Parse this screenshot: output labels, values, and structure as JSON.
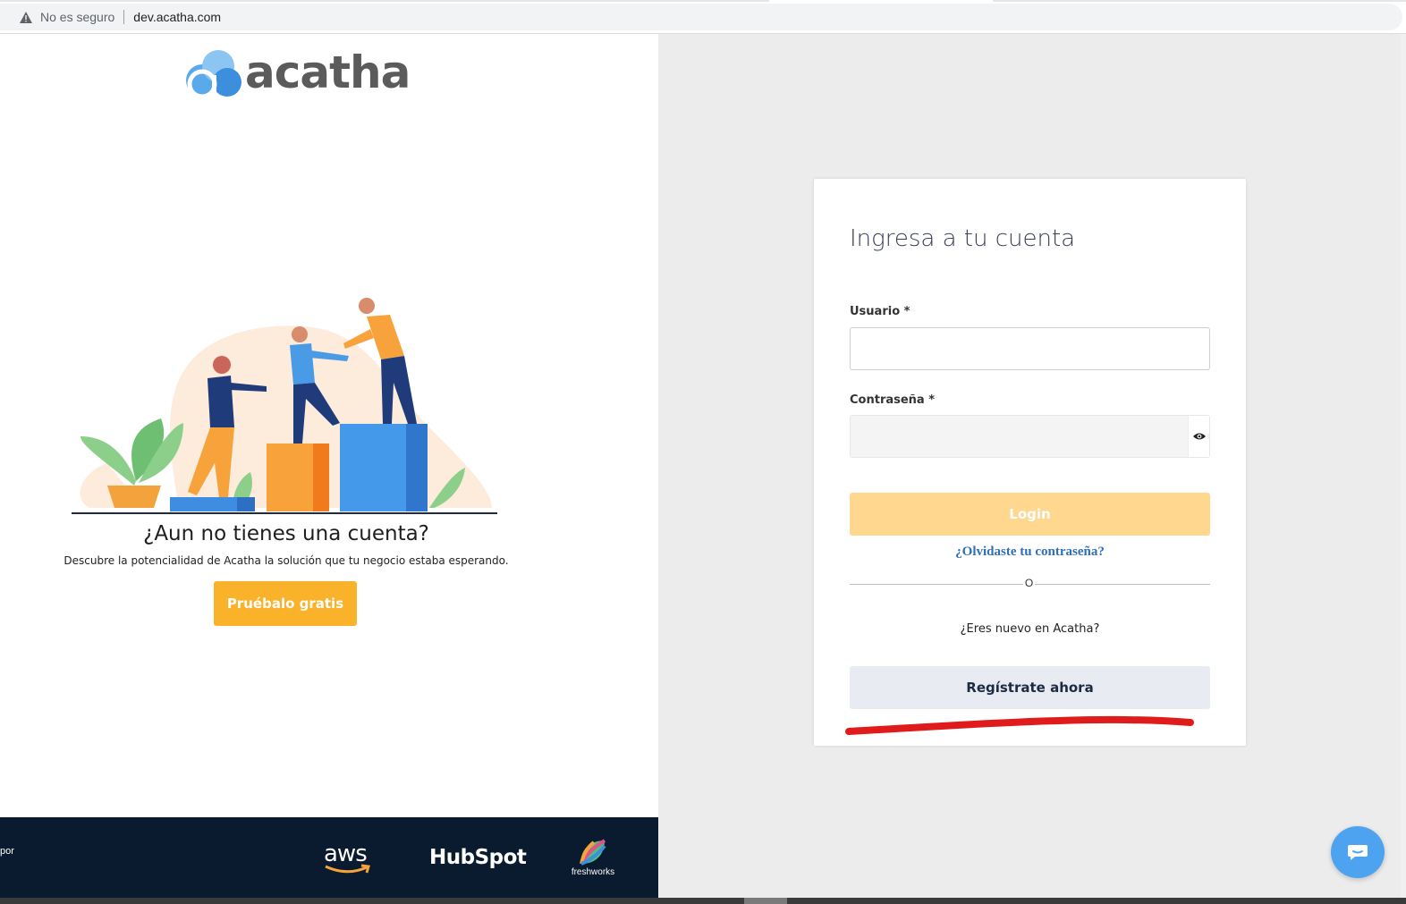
{
  "browser": {
    "security_label": "No es seguro",
    "url": "dev.acatha.com"
  },
  "brand": {
    "logo_text": "acatha",
    "colors": {
      "primary_yellow": "#fbb22b",
      "light_blue": "#4da3f0",
      "dark_navy": "#0b1b2f"
    }
  },
  "promo": {
    "title": "¿Aun no tienes una cuenta?",
    "subtitle": "Descubre la potencialidad de Acatha la solución que tu negocio estaba esperando.",
    "cta_label": "Pruébalo gratis"
  },
  "footer": {
    "partial_text": "por",
    "partners": [
      "aws",
      "HubSpot",
      "freshworks"
    ]
  },
  "login_card": {
    "title": "Ingresa a tu cuenta",
    "username_label": "Usuario *",
    "username_value": "",
    "password_label": "Contraseña *",
    "password_value": "",
    "login_label": "Login",
    "forgot_label": "¿Olvidaste tu contraseña?",
    "or_label": "O",
    "new_user_question": "¿Eres nuevo en Acatha?",
    "register_label": "Regístrate ahora"
  },
  "icons": {
    "warning": "warning-icon",
    "eye": "eye-icon",
    "chat": "chat-icon"
  }
}
